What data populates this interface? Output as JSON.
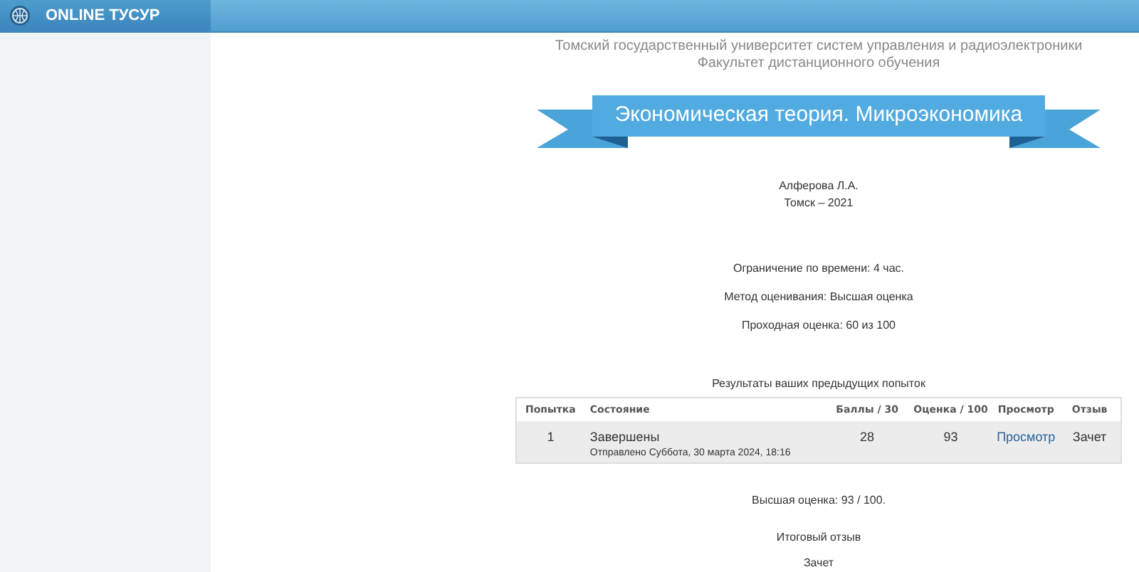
{
  "header": {
    "title": "ONLINE ТУСУР"
  },
  "page": {
    "university": "Томский государственный университет систем управления и радиоэлектроники",
    "faculty": "Факультет дистанционного обучения",
    "course_title": "Экономическая теория. Микроэкономика",
    "author": "Алферова Л.А.",
    "place_year": "Томск – 2021"
  },
  "quiz_info": [
    "Ограничение по времени: 4 час.",
    "Метод оценивания: Высшая оценка",
    "Проходная оценка: 60 из 100"
  ],
  "attempts_table": {
    "caption": "Результаты ваших предыдущих попыток",
    "columns": [
      "Попытка",
      "Состояние",
      "Баллы / 30",
      "Оценка / 100",
      "Просмотр",
      "Отзыв"
    ],
    "rows": [
      {
        "attempt": "1",
        "state": "Завершены",
        "submitted": "Отправлено Суббота, 30 марта 2024, 18:16",
        "points": "28",
        "grade": "93",
        "review": "Просмотр",
        "feedback": "Зачет"
      }
    ]
  },
  "highest_grade": "Высшая оценка: 93 / 100.",
  "overall_feedback": {
    "label": "Итоговый отзыв",
    "value": "Зачет"
  }
}
